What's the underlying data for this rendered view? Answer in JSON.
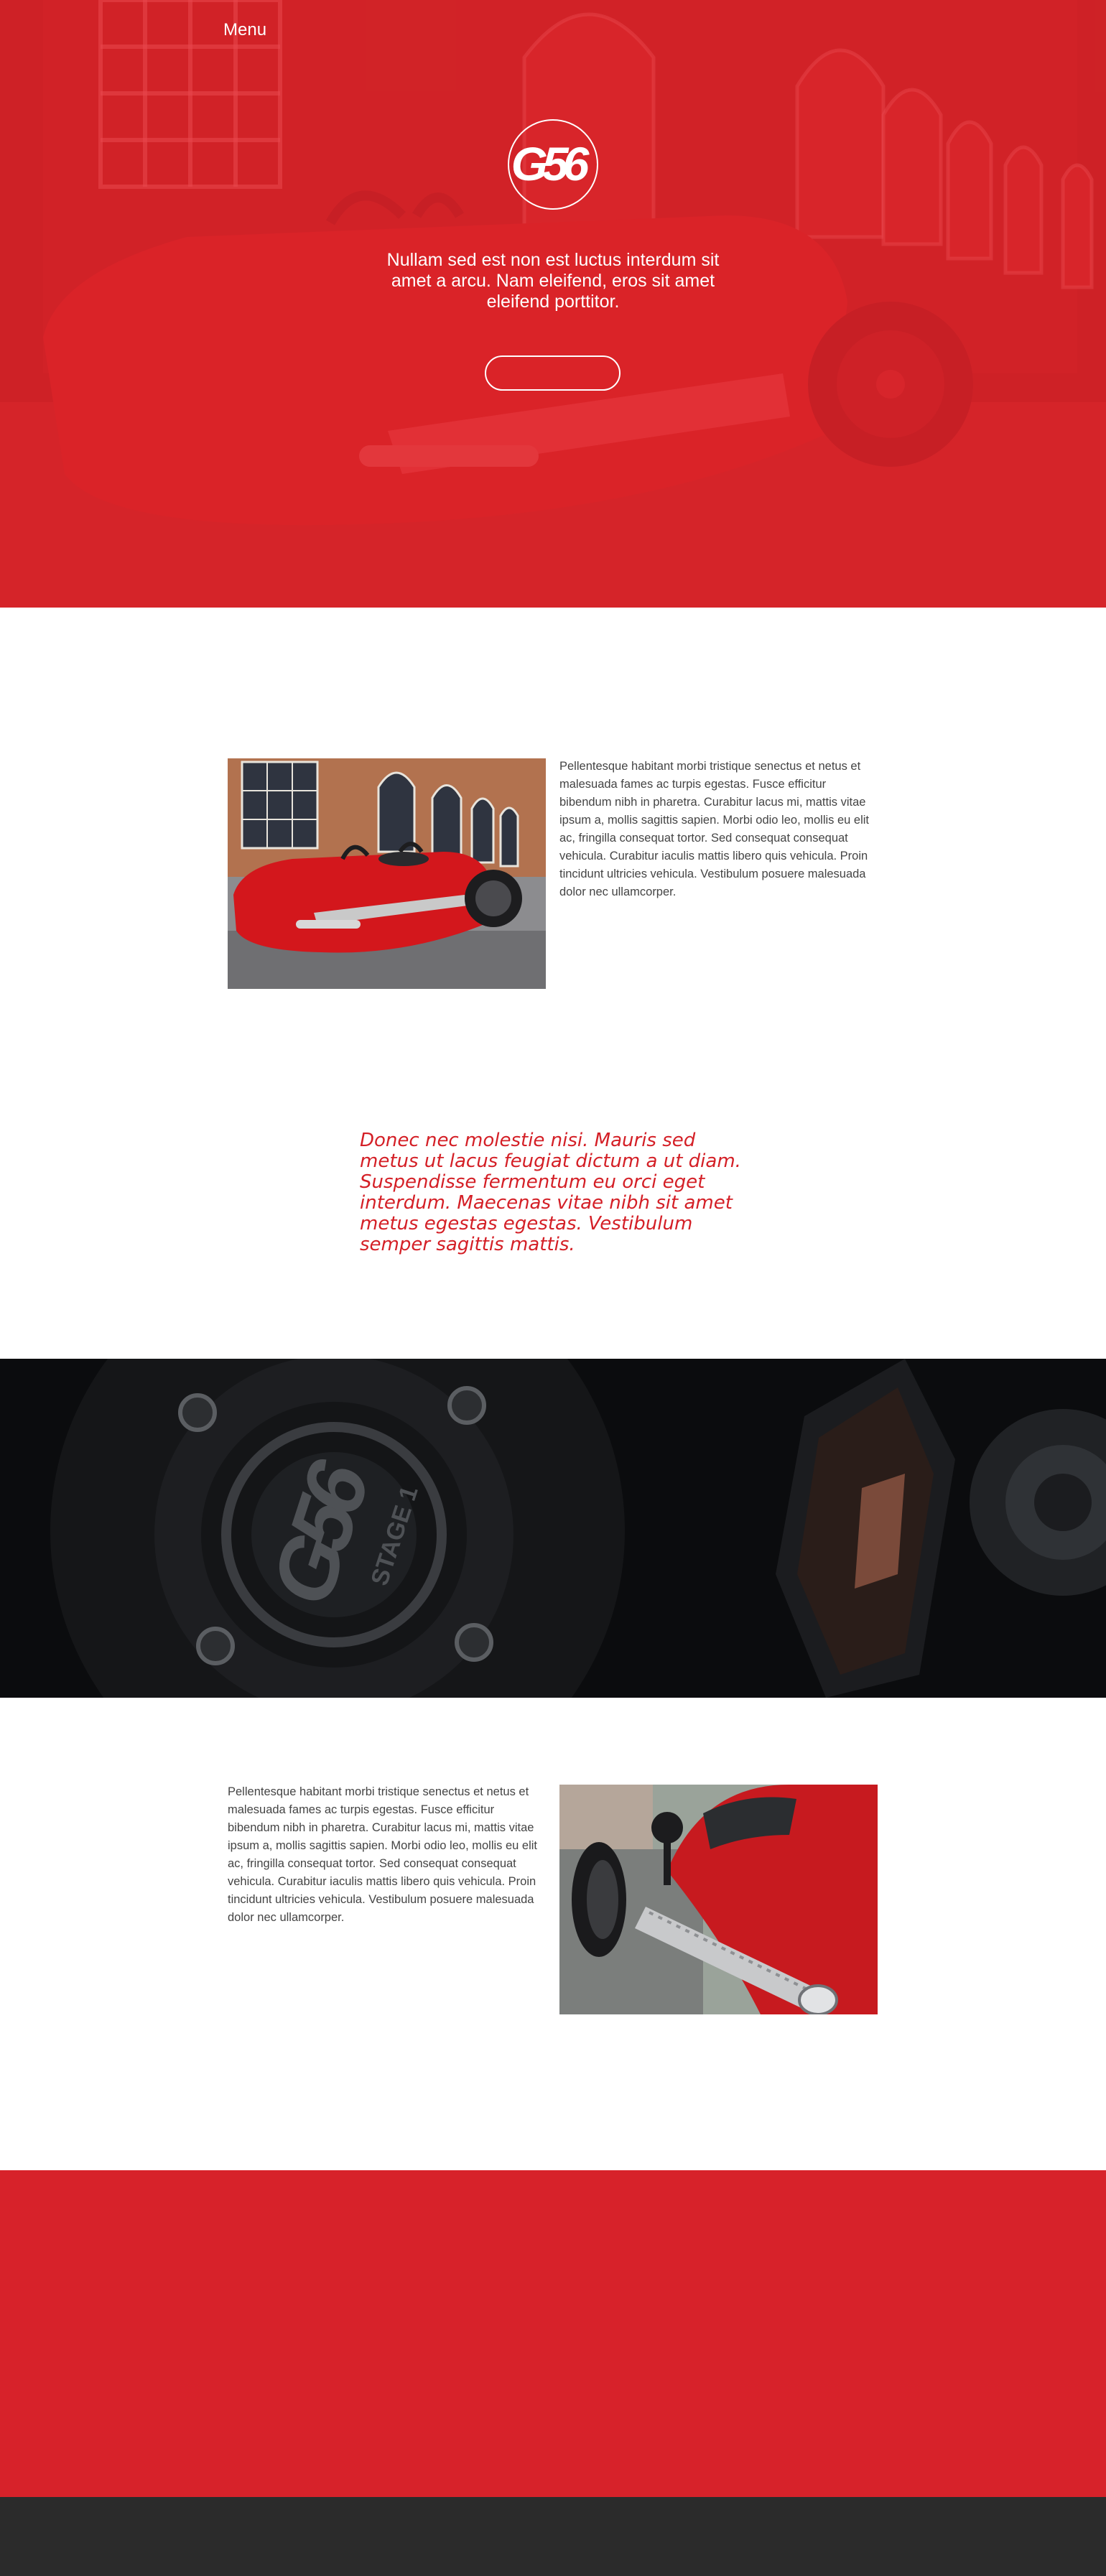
{
  "nav": {
    "menu_label": "Menu"
  },
  "hero": {
    "logo_text": "G56",
    "tagline": "Nullam sed est non est luctus interdum sit amet a arcu. Nam eleifend, eros sit amet eleifend porttitor.",
    "button_label": "",
    "accent_color": "#e5242b"
  },
  "section_one": {
    "paragraph": "Pellentesque habitant morbi tristique senectus et netus et malesuada fames ac turpis egestas. Fusce efficitur bibendum nibh in pharetra. Curabitur lacus mi, mattis vitae ipsum a, mollis sagittis sapien. Morbi odio leo, mollis eu elit ac, fringilla consequat tortor. Sed consequat consequat vehicula. Curabitur iaculis mattis libero quis vehicula. Proin tincidunt ultricies vehicula. Vestibulum posuere malesuada dolor nec ullamcorper."
  },
  "quote": {
    "text": "Donec nec molestie nisi. Mauris sed metus ut lacus feugiat dictum a ut diam. Suspendisse fermentum eu orci eget interdum. Maecenas vitae nibh sit amet metus egestas egestas. Vestibulum semper sagittis mattis.",
    "color": "#d41f26"
  },
  "engine_badge": {
    "logo_text": "G56",
    "stage_text": "STAGE 1"
  },
  "section_two": {
    "paragraph": "Pellentesque habitant morbi tristique senectus et netus et malesuada fames ac turpis egestas. Fusce efficitur bibendum nibh in pharetra. Curabitur lacus mi, mattis vitae ipsum a, mollis sagittis sapien. Morbi odio leo, mollis eu elit ac, fringilla consequat tortor. Sed consequat consequat vehicula. Curabitur iaculis mattis libero quis vehicula. Proin tincidunt ultricies vehicula. Vestibulum posuere malesuada dolor nec ullamcorper."
  },
  "colors": {
    "red_band": "#d7222a",
    "footer": "#2b2b2b"
  }
}
